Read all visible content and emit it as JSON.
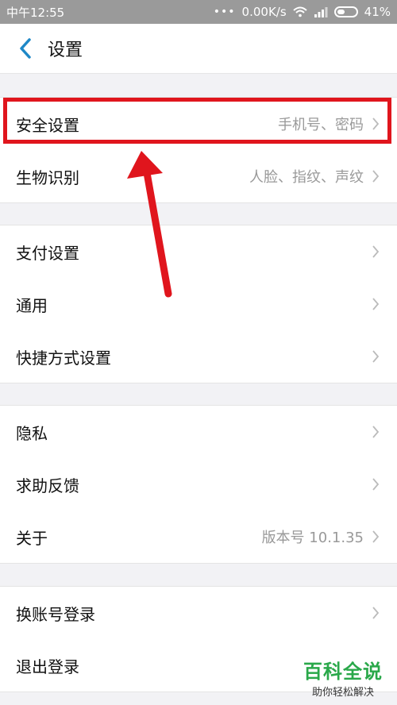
{
  "status_bar": {
    "time": "中午12:55",
    "network_speed": "0.00K/s",
    "battery": "41%"
  },
  "nav": {
    "title": "设置"
  },
  "groups": [
    {
      "items": [
        {
          "label": "安全设置",
          "value": "手机号、密码"
        },
        {
          "label": "生物识别",
          "value": "人脸、指纹、声纹"
        }
      ]
    },
    {
      "items": [
        {
          "label": "支付设置",
          "value": ""
        },
        {
          "label": "通用",
          "value": ""
        },
        {
          "label": "快捷方式设置",
          "value": ""
        }
      ]
    },
    {
      "items": [
        {
          "label": "隐私",
          "value": ""
        },
        {
          "label": "求助反馈",
          "value": ""
        },
        {
          "label": "关于",
          "value": "版本号 10.1.35"
        }
      ]
    },
    {
      "items": [
        {
          "label": "换账号登录",
          "value": ""
        },
        {
          "label": "退出登录",
          "value": ""
        }
      ]
    }
  ],
  "watermark": {
    "title": "百科全说",
    "subtitle": "助你轻松解决"
  },
  "colors": {
    "accent": "#1e88c7",
    "annotation_red": "#e0151d",
    "watermark_green": "#2aa84a"
  }
}
